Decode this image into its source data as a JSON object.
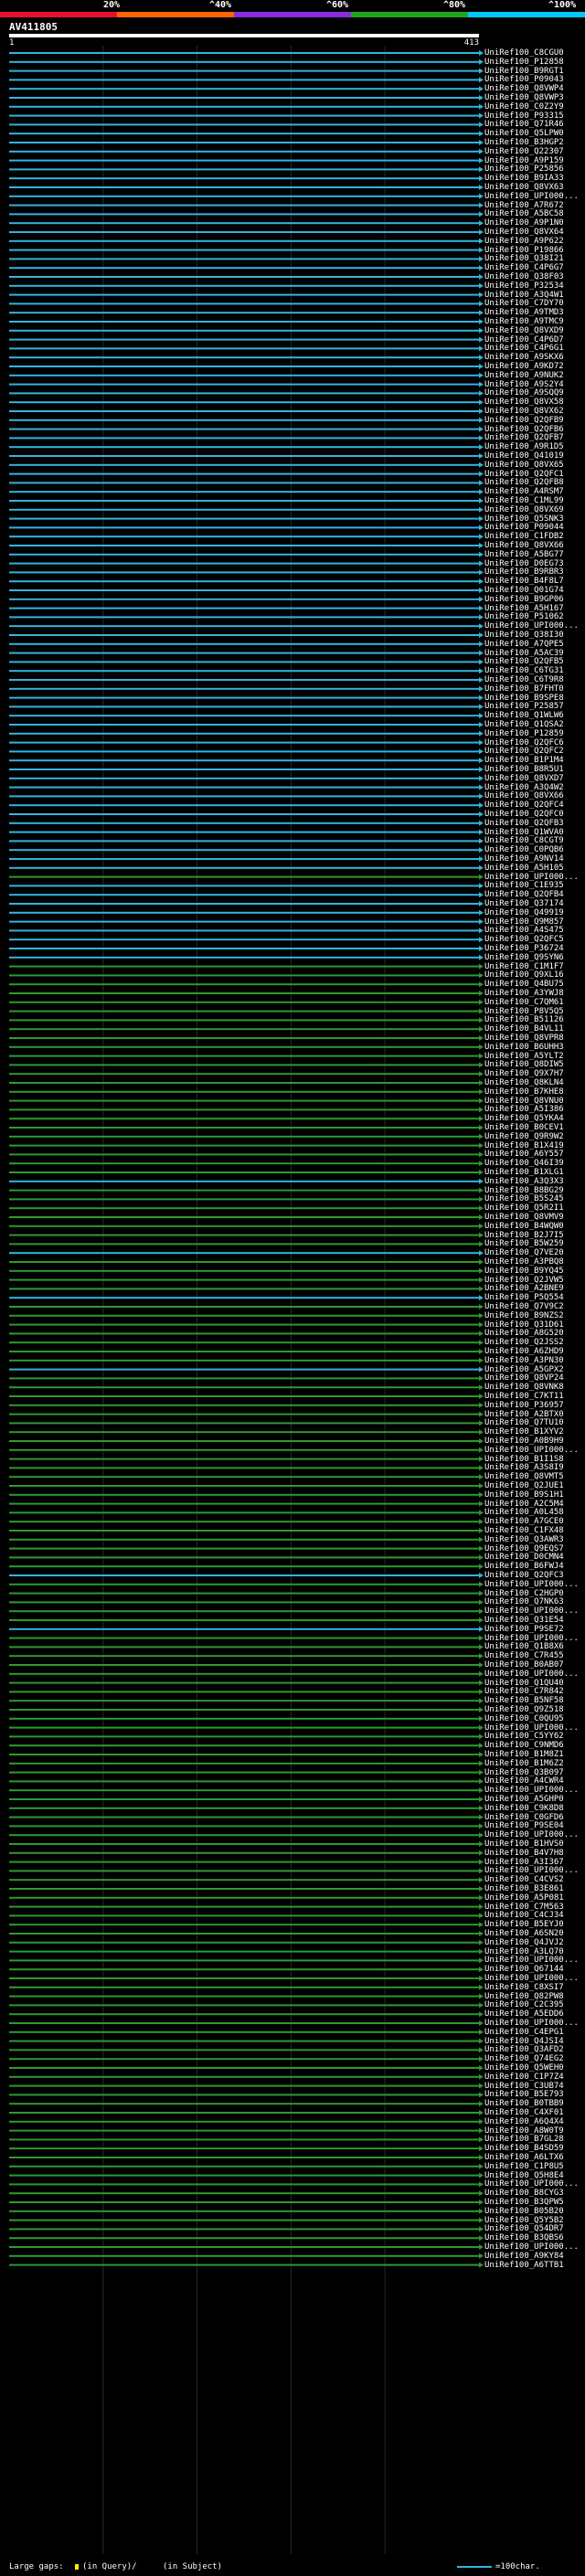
{
  "scale": {
    "labels": [
      "20%",
      "^40%",
      "^60%",
      "^80%",
      "^100%"
    ],
    "colors": [
      "#e8112d",
      "#ff6600",
      "#8a2be2",
      "#1fa81f",
      "#00c8ff"
    ]
  },
  "query": {
    "id": "AV411805",
    "start": "1",
    "end": "413"
  },
  "colors": {
    "cyan": "#34b4dc",
    "green": "#2e9a2e",
    "background": "#000000",
    "text": "#ffffff",
    "gap": "#ffee00"
  },
  "hits": [
    {
      "label": "UniRef100_C8CGU0",
      "color": "cyan"
    },
    {
      "label": "UniRef100_P12858",
      "color": "cyan"
    },
    {
      "label": "UniRef100_B9RGT1",
      "color": "cyan"
    },
    {
      "label": "UniRef100_P09043",
      "color": "cyan"
    },
    {
      "label": "UniRef100_Q8VWP4",
      "color": "cyan"
    },
    {
      "label": "UniRef100_Q8VWP3",
      "color": "cyan"
    },
    {
      "label": "UniRef100_C0Z2Y9",
      "color": "cyan"
    },
    {
      "label": "UniRef100_P93315",
      "color": "cyan"
    },
    {
      "label": "UniRef100_Q71R46",
      "color": "cyan"
    },
    {
      "label": "UniRef100_Q5LPW0",
      "color": "cyan"
    },
    {
      "label": "UniRef100_B3HGP2",
      "color": "cyan"
    },
    {
      "label": "UniRef100_Q22307",
      "color": "cyan"
    },
    {
      "label": "UniRef100_A9P159",
      "color": "cyan"
    },
    {
      "label": "UniRef100_P25856",
      "color": "cyan"
    },
    {
      "label": "UniRef100_B9IA33",
      "color": "cyan"
    },
    {
      "label": "UniRef100_Q8VX63",
      "color": "cyan"
    },
    {
      "label": "UniRef100_UPI000...",
      "color": "cyan"
    },
    {
      "label": "UniRef100_A7R672",
      "color": "cyan"
    },
    {
      "label": "UniRef100_A5BC58",
      "color": "cyan"
    },
    {
      "label": "UniRef100_A9P1N0",
      "color": "cyan"
    },
    {
      "label": "UniRef100_Q8VX64",
      "color": "cyan"
    },
    {
      "label": "UniRef100_A9P622",
      "color": "cyan"
    },
    {
      "label": "UniRef100_P19866",
      "color": "cyan"
    },
    {
      "label": "UniRef100_Q38I21",
      "color": "cyan"
    },
    {
      "label": "UniRef100_C4P6G7",
      "color": "cyan"
    },
    {
      "label": "UniRef100_Q38F03",
      "color": "cyan"
    },
    {
      "label": "UniRef100_P32534",
      "color": "cyan"
    },
    {
      "label": "UniRef100_A3Q4W1",
      "color": "cyan"
    },
    {
      "label": "UniRef100_C7DY70",
      "color": "cyan"
    },
    {
      "label": "UniRef100_A9TMD3",
      "color": "cyan"
    },
    {
      "label": "UniRef100_A9TMC9",
      "color": "cyan"
    },
    {
      "label": "UniRef100_Q8VXD9",
      "color": "cyan"
    },
    {
      "label": "UniRef100_C4P6D7",
      "color": "cyan"
    },
    {
      "label": "UniRef100_C4P6G1",
      "color": "cyan"
    },
    {
      "label": "UniRef100_A9SKX6",
      "color": "cyan"
    },
    {
      "label": "UniRef100_A9KD72",
      "color": "cyan"
    },
    {
      "label": "UniRef100_A9NUK2",
      "color": "cyan"
    },
    {
      "label": "UniRef100_A9S2Y4",
      "color": "cyan"
    },
    {
      "label": "UniRef100_A9SQQ9",
      "color": "cyan"
    },
    {
      "label": "UniRef100_Q8VX58",
      "color": "cyan"
    },
    {
      "label": "UniRef100_Q8VX62",
      "color": "cyan"
    },
    {
      "label": "UniRef100_Q2QFB9",
      "color": "cyan"
    },
    {
      "label": "UniRef100_Q2QFB6",
      "color": "cyan"
    },
    {
      "label": "UniRef100_Q2QFB7",
      "color": "cyan"
    },
    {
      "label": "UniRef100_A9R1D5",
      "color": "cyan"
    },
    {
      "label": "UniRef100_Q41019",
      "color": "cyan"
    },
    {
      "label": "UniRef100_Q8VX65",
      "color": "cyan"
    },
    {
      "label": "UniRef100_Q2QFC1",
      "color": "cyan"
    },
    {
      "label": "UniRef100_Q2QFB8",
      "color": "cyan"
    },
    {
      "label": "UniRef100_A4RSM7",
      "color": "cyan"
    },
    {
      "label": "UniRef100_C1ML99",
      "color": "cyan"
    },
    {
      "label": "UniRef100_Q8VX69",
      "color": "cyan"
    },
    {
      "label": "UniRef100_Q5SNK3",
      "color": "cyan"
    },
    {
      "label": "UniRef100_P09044",
      "color": "cyan"
    },
    {
      "label": "UniRef100_C1FDB2",
      "color": "cyan"
    },
    {
      "label": "UniRef100_Q8VX66",
      "color": "cyan"
    },
    {
      "label": "UniRef100_A5BG77",
      "color": "cyan"
    },
    {
      "label": "UniRef100_D0EG73",
      "color": "cyan"
    },
    {
      "label": "UniRef100_B9RBR3",
      "color": "cyan"
    },
    {
      "label": "UniRef100_B4F8L7",
      "color": "cyan"
    },
    {
      "label": "UniRef100_Q01G74",
      "color": "cyan"
    },
    {
      "label": "UniRef100_B9GP06",
      "color": "cyan"
    },
    {
      "label": "UniRef100_A5H167",
      "color": "cyan"
    },
    {
      "label": "UniRef100_P51062",
      "color": "cyan"
    },
    {
      "label": "UniRef100_UPI000...",
      "color": "cyan"
    },
    {
      "label": "UniRef100_Q38I30",
      "color": "cyan"
    },
    {
      "label": "UniRef100_A7QPE5",
      "color": "cyan"
    },
    {
      "label": "UniRef100_A5AC39",
      "color": "cyan"
    },
    {
      "label": "UniRef100_Q2QFB5",
      "color": "cyan"
    },
    {
      "label": "UniRef100_C6TG31",
      "color": "cyan"
    },
    {
      "label": "UniRef100_C6T9R8",
      "color": "cyan"
    },
    {
      "label": "UniRef100_B7FHT0",
      "color": "cyan"
    },
    {
      "label": "UniRef100_B9SPE8",
      "color": "cyan"
    },
    {
      "label": "UniRef100_P25857",
      "color": "cyan"
    },
    {
      "label": "UniRef100_Q1WLW6",
      "color": "cyan"
    },
    {
      "label": "UniRef100_Q1QSA2",
      "color": "cyan"
    },
    {
      "label": "UniRef100_P12859",
      "color": "cyan"
    },
    {
      "label": "UniRef100_Q2QFC6",
      "color": "cyan"
    },
    {
      "label": "UniRef100_Q2QFC2",
      "color": "cyan"
    },
    {
      "label": "UniRef100_B1P1M4",
      "color": "cyan"
    },
    {
      "label": "UniRef100_B8R5U1",
      "color": "cyan"
    },
    {
      "label": "UniRef100_Q8VXD7",
      "color": "cyan"
    },
    {
      "label": "UniRef100_A3Q4W2",
      "color": "cyan"
    },
    {
      "label": "UniRef100_Q8VX66",
      "color": "cyan"
    },
    {
      "label": "UniRef100_Q2QFC4",
      "color": "cyan"
    },
    {
      "label": "UniRef100_Q2QFC0",
      "color": "cyan"
    },
    {
      "label": "UniRef100_Q2QFB3",
      "color": "cyan"
    },
    {
      "label": "UniRef100_Q1WVA0",
      "color": "cyan"
    },
    {
      "label": "UniRef100_C8CGT9",
      "color": "cyan"
    },
    {
      "label": "UniRef100_C0PQB6",
      "color": "cyan"
    },
    {
      "label": "UniRef100_A9NV14",
      "color": "cyan"
    },
    {
      "label": "UniRef100_A5H105",
      "color": "cyan"
    },
    {
      "label": "UniRef100_UPI000...",
      "color": "green"
    },
    {
      "label": "UniRef100_C1E935",
      "color": "cyan"
    },
    {
      "label": "UniRef100_Q2QFB4",
      "color": "cyan"
    },
    {
      "label": "UniRef100_Q37174",
      "color": "cyan"
    },
    {
      "label": "UniRef100_Q49919",
      "color": "cyan"
    },
    {
      "label": "UniRef100_Q9M857",
      "color": "cyan"
    },
    {
      "label": "UniRef100_A4S475",
      "color": "cyan"
    },
    {
      "label": "UniRef100_Q2QFC5",
      "color": "cyan"
    },
    {
      "label": "UniRef100_P36724",
      "color": "cyan"
    },
    {
      "label": "UniRef100_Q9SYN6",
      "color": "cyan"
    },
    {
      "label": "UniRef100_C1M1F7",
      "color": "green"
    },
    {
      "label": "UniRef100_Q9XL16",
      "color": "green"
    },
    {
      "label": "UniRef100_Q4BU75",
      "color": "green"
    },
    {
      "label": "UniRef100_A3YWJ8",
      "color": "green"
    },
    {
      "label": "UniRef100_C7QM61",
      "color": "green"
    },
    {
      "label": "UniRef100_P8V5Q5",
      "color": "green"
    },
    {
      "label": "UniRef100_B51126",
      "color": "green"
    },
    {
      "label": "UniRef100_B4VL11",
      "color": "green"
    },
    {
      "label": "UniRef100_Q8VPR8",
      "color": "green"
    },
    {
      "label": "UniRef100_B6UHH3",
      "color": "green"
    },
    {
      "label": "UniRef100_A5YLT2",
      "color": "green"
    },
    {
      "label": "UniRef100_Q8DIW5",
      "color": "green"
    },
    {
      "label": "UniRef100_Q9X7H7",
      "color": "green"
    },
    {
      "label": "UniRef100_Q8KLN4",
      "color": "green"
    },
    {
      "label": "UniRef100_B7KHE8",
      "color": "green"
    },
    {
      "label": "UniRef100_Q8VNU0",
      "color": "green"
    },
    {
      "label": "UniRef100_A5I386",
      "color": "green"
    },
    {
      "label": "UniRef100_Q5YKA4",
      "color": "green"
    },
    {
      "label": "UniRef100_B0CEV1",
      "color": "green"
    },
    {
      "label": "UniRef100_Q9R9W2",
      "color": "green"
    },
    {
      "label": "UniRef100_B1X419",
      "color": "green"
    },
    {
      "label": "UniRef100_A6Y557",
      "color": "green"
    },
    {
      "label": "UniRef100_Q46I39",
      "color": "green"
    },
    {
      "label": "UniRef100_B1XLG1",
      "color": "green"
    },
    {
      "label": "UniRef100_A3Q3X3",
      "color": "cyan"
    },
    {
      "label": "UniRef100_B8BG29",
      "color": "green"
    },
    {
      "label": "UniRef100_B5S245",
      "color": "green"
    },
    {
      "label": "UniRef100_Q5R2I1",
      "color": "green"
    },
    {
      "label": "UniRef100_Q8VMV9",
      "color": "green"
    },
    {
      "label": "UniRef100_B4WQW0",
      "color": "green"
    },
    {
      "label": "UniRef100_B2J7I5",
      "color": "green"
    },
    {
      "label": "UniRef100_B5W259",
      "color": "green"
    },
    {
      "label": "UniRef100_Q7VE20",
      "color": "cyan"
    },
    {
      "label": "UniRef100_A3PBQ8",
      "color": "green"
    },
    {
      "label": "UniRef100_B9YQ45",
      "color": "green"
    },
    {
      "label": "UniRef100_Q2JVW5",
      "color": "green"
    },
    {
      "label": "UniRef100_A2BNE9",
      "color": "green"
    },
    {
      "label": "UniRef100_P5Q554",
      "color": "cyan"
    },
    {
      "label": "UniRef100_Q7V9C2",
      "color": "green"
    },
    {
      "label": "UniRef100_B9NZS2",
      "color": "green"
    },
    {
      "label": "UniRef100_Q31D61",
      "color": "green"
    },
    {
      "label": "UniRef100_A8G520",
      "color": "green"
    },
    {
      "label": "UniRef100_Q2JSS2",
      "color": "green"
    },
    {
      "label": "UniRef100_A6ZHD9",
      "color": "green"
    },
    {
      "label": "UniRef100_A3PN30",
      "color": "green"
    },
    {
      "label": "UniRef100_A5GPX2",
      "color": "cyan"
    },
    {
      "label": "UniRef100_Q8VP24",
      "color": "green"
    },
    {
      "label": "UniRef100_Q8VNK8",
      "color": "green"
    },
    {
      "label": "UniRef100_C7KT11",
      "color": "green"
    },
    {
      "label": "UniRef100_P36957",
      "color": "green"
    },
    {
      "label": "UniRef100_A2BTX0",
      "color": "green"
    },
    {
      "label": "UniRef100_Q7TU10",
      "color": "green"
    },
    {
      "label": "UniRef100_B1XYV2",
      "color": "green"
    },
    {
      "label": "UniRef100_A0B9H9",
      "color": "green"
    },
    {
      "label": "UniRef100_UPI000...",
      "color": "green"
    },
    {
      "label": "UniRef100_B1I1S8",
      "color": "green"
    },
    {
      "label": "UniRef100_A3S8I9",
      "color": "green"
    },
    {
      "label": "UniRef100_Q8VMT5",
      "color": "green"
    },
    {
      "label": "UniRef100_Q2JUE1",
      "color": "green"
    },
    {
      "label": "UniRef100_B9S1H1",
      "color": "green"
    },
    {
      "label": "UniRef100_A2C5M4",
      "color": "green"
    },
    {
      "label": "UniRef100_A0L458",
      "color": "green"
    },
    {
      "label": "UniRef100_A7GCE0",
      "color": "green"
    },
    {
      "label": "UniRef100_C1FX48",
      "color": "green"
    },
    {
      "label": "UniRef100_Q3AWR3",
      "color": "green"
    },
    {
      "label": "UniRef100_Q9EQS7",
      "color": "green"
    },
    {
      "label": "UniRef100_D0CMN4",
      "color": "green"
    },
    {
      "label": "UniRef100_B6FWJ4",
      "color": "green"
    },
    {
      "label": "UniRef100_Q2QFC3",
      "color": "cyan"
    },
    {
      "label": "UniRef100_UPI000...",
      "color": "green"
    },
    {
      "label": "UniRef100_C2HGP0",
      "color": "green"
    },
    {
      "label": "UniRef100_Q7NK63",
      "color": "green"
    },
    {
      "label": "UniRef100_UPI000...",
      "color": "green"
    },
    {
      "label": "UniRef100_Q31E54",
      "color": "green"
    },
    {
      "label": "UniRef100_P9SE72",
      "color": "cyan"
    },
    {
      "label": "UniRef100_UPI000...",
      "color": "green"
    },
    {
      "label": "UniRef100_Q1B8X6",
      "color": "green"
    },
    {
      "label": "UniRef100_C7R455",
      "color": "green"
    },
    {
      "label": "UniRef100_B0AB07",
      "color": "green"
    },
    {
      "label": "UniRef100_UPI000...",
      "color": "green"
    },
    {
      "label": "UniRef100_Q1QU40",
      "color": "green"
    },
    {
      "label": "UniRef100_C7R842",
      "color": "green"
    },
    {
      "label": "UniRef100_B5NF58",
      "color": "green"
    },
    {
      "label": "UniRef100_Q9Z518",
      "color": "green"
    },
    {
      "label": "UniRef100_C0QU95",
      "color": "green"
    },
    {
      "label": "UniRef100_UPI000...",
      "color": "green"
    },
    {
      "label": "UniRef100_C5YY62",
      "color": "green"
    },
    {
      "label": "UniRef100_C9NMD6",
      "color": "green"
    },
    {
      "label": "UniRef100_B1M8Z1",
      "color": "green"
    },
    {
      "label": "UniRef100_B1M6Z2",
      "color": "green"
    },
    {
      "label": "UniRef100_Q3B097",
      "color": "green"
    },
    {
      "label": "UniRef100_A4CWR4",
      "color": "green"
    },
    {
      "label": "UniRef100_UPI000...",
      "color": "green"
    },
    {
      "label": "UniRef100_A5GHP0",
      "color": "green"
    },
    {
      "label": "UniRef100_C9K8D8",
      "color": "green"
    },
    {
      "label": "UniRef100_C0GFD6",
      "color": "green"
    },
    {
      "label": "UniRef100_P9SE04",
      "color": "green"
    },
    {
      "label": "UniRef100_UPI000...",
      "color": "green"
    },
    {
      "label": "UniRef100_B1HVS0",
      "color": "green"
    },
    {
      "label": "UniRef100_B4V7H8",
      "color": "green"
    },
    {
      "label": "UniRef100_A3I367",
      "color": "green"
    },
    {
      "label": "UniRef100_UPI000...",
      "color": "green"
    },
    {
      "label": "UniRef100_C4CVS2",
      "color": "green"
    },
    {
      "label": "UniRef100_B3E861",
      "color": "green"
    },
    {
      "label": "UniRef100_A5P081",
      "color": "green"
    },
    {
      "label": "UniRef100_C7M563",
      "color": "green"
    },
    {
      "label": "UniRef100_C4CJ34",
      "color": "green"
    },
    {
      "label": "UniRef100_B5EYJ0",
      "color": "green"
    },
    {
      "label": "UniRef100_A6SN20",
      "color": "green"
    },
    {
      "label": "UniRef100_Q4JVJ2",
      "color": "green"
    },
    {
      "label": "UniRef100_A3LQ70",
      "color": "green"
    },
    {
      "label": "UniRef100_UPI000...",
      "color": "green"
    },
    {
      "label": "UniRef100_Q67144",
      "color": "green"
    },
    {
      "label": "UniRef100_UPI000...",
      "color": "green"
    },
    {
      "label": "UniRef100_C8XSI7",
      "color": "green"
    },
    {
      "label": "UniRef100_Q82PW8",
      "color": "green"
    },
    {
      "label": "UniRef100_C2C395",
      "color": "green"
    },
    {
      "label": "UniRef100_A5EDD6",
      "color": "green"
    },
    {
      "label": "UniRef100_UPI000...",
      "color": "green"
    },
    {
      "label": "UniRef100_C4EPG1",
      "color": "green"
    },
    {
      "label": "UniRef100_Q4JSI4",
      "color": "green"
    },
    {
      "label": "UniRef100_Q3AFD2",
      "color": "green"
    },
    {
      "label": "UniRef100_Q74EG2",
      "color": "green"
    },
    {
      "label": "UniRef100_Q5WEH0",
      "color": "green"
    },
    {
      "label": "UniRef100_C1P7Z4",
      "color": "green"
    },
    {
      "label": "UniRef100_C3UB74",
      "color": "green"
    },
    {
      "label": "UniRef100_B5E793",
      "color": "green"
    },
    {
      "label": "UniRef100_B0TBB9",
      "color": "green"
    },
    {
      "label": "UniRef100_C4XF01",
      "color": "green"
    },
    {
      "label": "UniRef100_A6Q4X4",
      "color": "green"
    },
    {
      "label": "UniRef100_A8W0T9",
      "color": "green"
    },
    {
      "label": "UniRef100_B7GL28",
      "color": "green"
    },
    {
      "label": "UniRef100_B4SD59",
      "color": "green"
    },
    {
      "label": "UniRef100_A6LTX6",
      "color": "green"
    },
    {
      "label": "UniRef100_C1P8U5",
      "color": "green"
    },
    {
      "label": "UniRef100_Q5H8E4",
      "color": "green"
    },
    {
      "label": "UniRef100_UPI000...",
      "color": "green"
    },
    {
      "label": "UniRef100_B8CYG3",
      "color": "green"
    },
    {
      "label": "UniRef100_B3QPW5",
      "color": "green"
    },
    {
      "label": "UniRef100_B05B20",
      "color": "green"
    },
    {
      "label": "UniRef100_Q5Y5B2",
      "color": "green"
    },
    {
      "label": "UniRef100_Q54DR7",
      "color": "green"
    },
    {
      "label": "UniRef100_B3QBS6",
      "color": "green"
    },
    {
      "label": "UniRef100_UPI000...",
      "color": "green"
    },
    {
      "label": "UniRef100_A9KY84",
      "color": "green"
    },
    {
      "label": "UniRef100_A6TTB1",
      "color": "green"
    }
  ],
  "footer": {
    "gaps_prefix": "Large gaps:",
    "query_gap": "(in Query)/",
    "subject_gap": "(in Subject)",
    "scale_text": "=100char."
  }
}
